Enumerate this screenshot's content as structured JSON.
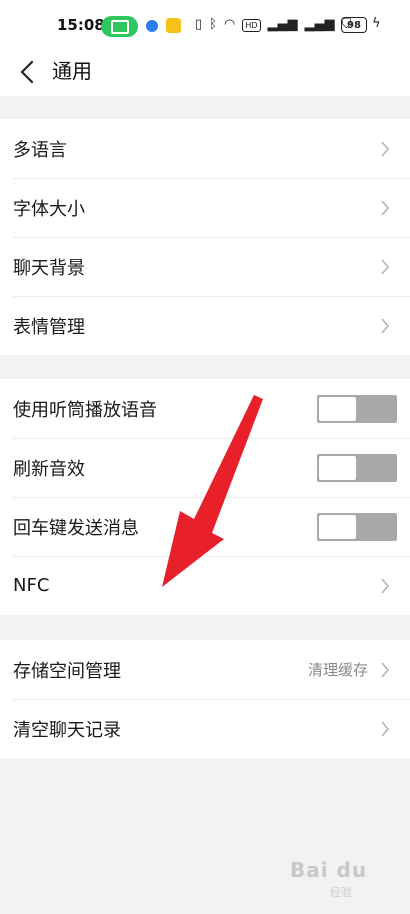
{
  "status_bar": {
    "time": "15:08",
    "battery": "98",
    "hd_label": "HD"
  },
  "header": {
    "title": "通用"
  },
  "groups": [
    {
      "items": [
        {
          "label": "多语言"
        },
        {
          "label": "字体大小"
        },
        {
          "label": "聊天背景"
        },
        {
          "label": "表情管理"
        }
      ]
    },
    {
      "items": [
        {
          "label": "使用听筒播放语音",
          "toggle": false
        },
        {
          "label": "刷新音效",
          "toggle": false
        },
        {
          "label": "回车键发送消息",
          "toggle": false
        },
        {
          "label": "NFC"
        }
      ]
    },
    {
      "items": [
        {
          "label": "存储空间管理",
          "value": "清理缓存"
        },
        {
          "label": "清空聊天记录"
        }
      ]
    }
  ],
  "colors": {
    "accent_green": "#2fc65e",
    "annotation_arrow": "#e8202a",
    "toggle_off": "#a9a9a9"
  },
  "watermark": {
    "text": "Bai du",
    "sub": "经验"
  }
}
